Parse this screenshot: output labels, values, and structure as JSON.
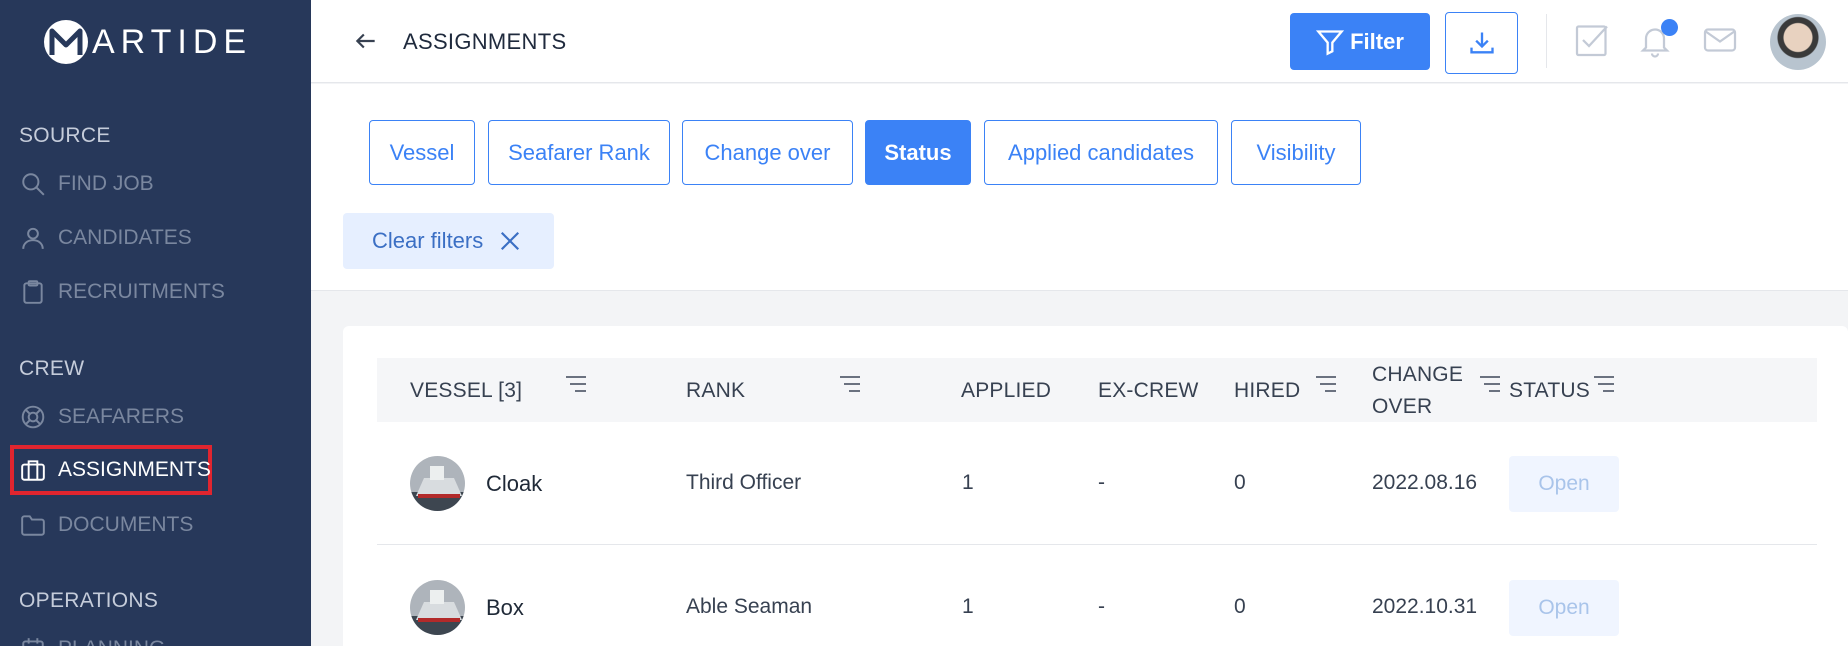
{
  "brand": {
    "logo_text": "ARTIDE"
  },
  "sidebar": {
    "source_title": "SOURCE",
    "source_items": [
      {
        "label": "FIND JOB",
        "icon": "search-icon"
      },
      {
        "label": "CANDIDATES",
        "icon": "user-icon"
      },
      {
        "label": "RECRUITMENTS",
        "icon": "clipboard-icon"
      }
    ],
    "crew_title": "CREW",
    "crew_items": [
      {
        "label": "SEAFARERS",
        "icon": "lifebuoy-icon"
      },
      {
        "label": "ASSIGNMENTS",
        "icon": "briefcase-icon"
      },
      {
        "label": "DOCUMENTS",
        "icon": "folder-icon"
      }
    ],
    "operations_title": "OPERATIONS",
    "operations_items": [
      {
        "label": "PLANNING",
        "icon": "calendar-icon"
      }
    ]
  },
  "header": {
    "title": "ASSIGNMENTS",
    "filter_label": "Filter"
  },
  "filters": {
    "chips": [
      "Vessel",
      "Seafarer Rank",
      "Change over",
      "Status",
      "Applied candidates",
      "Visibility"
    ],
    "active": "Status",
    "clear_label": "Clear filters"
  },
  "table": {
    "headers": {
      "vessel": "VESSEL [3]",
      "rank": "RANK",
      "applied": "APPLIED",
      "excrew": "EX-CREW",
      "hired": "HIRED",
      "changeover_1": "CHANGE",
      "changeover_2": "OVER",
      "status": "STATUS"
    },
    "rows": [
      {
        "vessel": "Cloak",
        "rank": "Third Officer",
        "applied": "1",
        "excrew": "-",
        "hired": "0",
        "changeover": "2022.08.16",
        "status": "Open"
      },
      {
        "vessel": "Box",
        "rank": "Able Seaman",
        "applied": "1",
        "excrew": "-",
        "hired": "0",
        "changeover": "2022.10.31",
        "status": "Open"
      }
    ]
  },
  "colors": {
    "sidebar": "#27385a",
    "accent": "#3b82f6",
    "highlight": "#e0252f"
  }
}
